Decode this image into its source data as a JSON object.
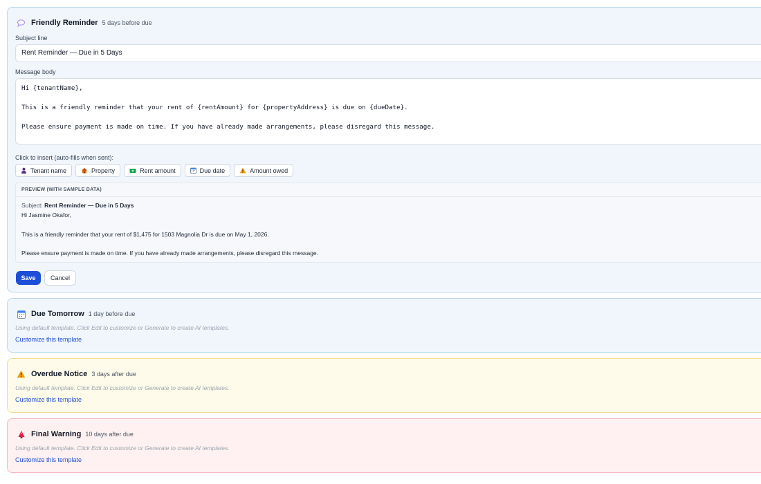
{
  "friendly": {
    "title": "Friendly Reminder",
    "timing": "5 days before due",
    "subject_label": "Subject line",
    "subject_value": "Rent Reminder — Due in 5 Days",
    "body_label": "Message body",
    "body_value": "Hi {tenantName},\n\nThis is a friendly reminder that your rent of {rentAmount} for {propertyAddress} is due on {dueDate}.\n\nPlease ensure payment is made on time. If you have already made arrangements, please disregard this message.",
    "insert_label": "Click to insert (auto-fills when sent):",
    "chips": [
      {
        "label": "Tenant name",
        "icon": "person-icon"
      },
      {
        "label": "Property",
        "icon": "house-icon"
      },
      {
        "label": "Rent amount",
        "icon": "money-icon"
      },
      {
        "label": "Due date",
        "icon": "calendar-icon"
      },
      {
        "label": "Amount owed",
        "icon": "warning-icon"
      }
    ],
    "preview": {
      "heading": "PREVIEW (WITH SAMPLE DATA)",
      "subject_prefix": "Subject:",
      "subject": "Rent Reminder — Due in 5 Days",
      "line1": "Hi Jasmine Okafor,",
      "line2": "This is a friendly reminder that your rent of $1,475 for 1503 Magnolia Dr is due on May 1, 2026.",
      "line3": "Please ensure payment is made on time. If you have already made arrangements, please disregard this message."
    },
    "save_label": "Save",
    "cancel_label": "Cancel"
  },
  "templates": [
    {
      "title": "Due Tomorrow",
      "timing": "1 day before due",
      "hint": "Using default template. Click Edit to customize or Generate to create AI templates.",
      "link": "Customize this template",
      "icon": "calendar-icon"
    },
    {
      "title": "Overdue Notice",
      "timing": "3 days after due",
      "hint": "Using default template. Click Edit to customize or Generate to create AI templates.",
      "link": "Customize this template",
      "icon": "warning-icon"
    },
    {
      "title": "Final Warning",
      "timing": "10 days after due",
      "hint": "Using default template. Click Edit to customize or Generate to create AI templates.",
      "link": "Customize this template",
      "icon": "alarm-bell-icon"
    }
  ],
  "colors": {
    "accent": "#1d4ed8",
    "blue_card": "#f1f6fd",
    "yellow_card": "#fffbea",
    "red_card": "#fff1f1"
  }
}
